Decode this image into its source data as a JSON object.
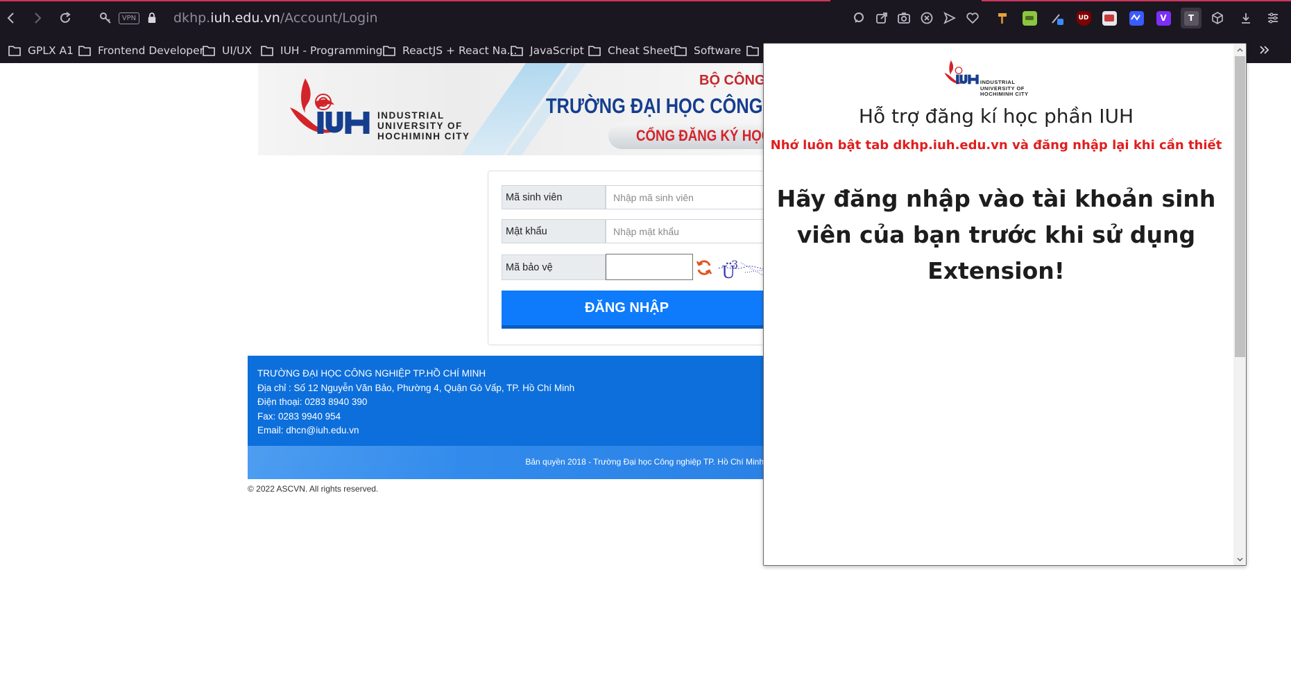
{
  "browser": {
    "url_scheme_host_prefix": "dkhp.",
    "url_host": "iuh.edu.vn",
    "url_path": "/Account/Login",
    "vpn_label": "VPN",
    "bookmarks": [
      "GPLX A1",
      "Frontend Developer",
      "UI/UX",
      "IUH - Programming",
      "ReactJS + React Na...",
      "JavaScript",
      "Cheat Sheet",
      "Software"
    ],
    "extensions": [
      "search-icon",
      "send-icon",
      "camera-icon",
      "close-circle-icon",
      "play-icon",
      "heart-icon",
      "hammer-icon",
      "pear-icon",
      "pen-icon",
      "ublock-icon",
      "wikiless-icon",
      "translate-icon",
      "v-icon",
      "t-extension-icon",
      "cube-icon",
      "download-icon",
      "menu-icon"
    ],
    "ext_ublock_label": "UD",
    "ext_v_label": "V",
    "ext_t_label": "T"
  },
  "banner": {
    "logo_text": [
      "INDUSTRIAL",
      "UNIVERSITY OF",
      "HOCHIMINH CITY"
    ],
    "ministry": "BỘ CÔNG T",
    "title": "TRƯỜNG ĐẠI HỌC CÔNG N",
    "subtitle": "CỔNG ĐĂNG KÝ HỌC"
  },
  "login": {
    "student_id_label": "Mã sinh viên",
    "student_id_placeholder": "Nhập mã sinh viên",
    "password_label": "Mật khẩu",
    "password_placeholder": "Nhập mật khẩu",
    "captcha_label": "Mã bảo vệ",
    "captcha_value": "",
    "submit_label": "ĐĂNG NHẬP"
  },
  "footer": {
    "school": "TRƯỜNG ĐẠI HỌC CÔNG NGHIỆP TP.HỒ CHÍ MINH",
    "address": "Địa chỉ : Số 12 Nguyễn Văn Bảo, Phường 4, Quận Gò Vấp, TP. Hồ Chí Minh",
    "phone": "Điện thoại: 0283 8940 390",
    "fax": "Fax: 0283 9940 954",
    "email": "Email: dhcn@iuh.edu.vn",
    "copyright_bar": "Bản quyền 2018 - Trường Đại học Công nghiệp TP. Hồ Chí Minh",
    "page_copyright": "© 2022 ASCVN. All rights reserved."
  },
  "popup": {
    "logo_text": [
      "INDUSTRIAL",
      "UNIVERSITY OF",
      "HOCHIMINH CITY"
    ],
    "title": "Hỗ trợ đăng kí học phần IUH",
    "note": "Nhớ luôn bật tab dkhp.iuh.edu.vn và đăng nhập lại khi cần thiết",
    "message": "Hãy đăng nhập vào tài khoản sinh viên của bạn trước khi sử dụng Extension!"
  },
  "colors": {
    "chrome_bg": "#1b1720",
    "brand_red": "#d3242a",
    "brand_blue": "#163e8e",
    "button_blue": "#0d7bfb",
    "footer_blue": "#0d6fdb",
    "popup_note_red": "#e11d1d"
  }
}
